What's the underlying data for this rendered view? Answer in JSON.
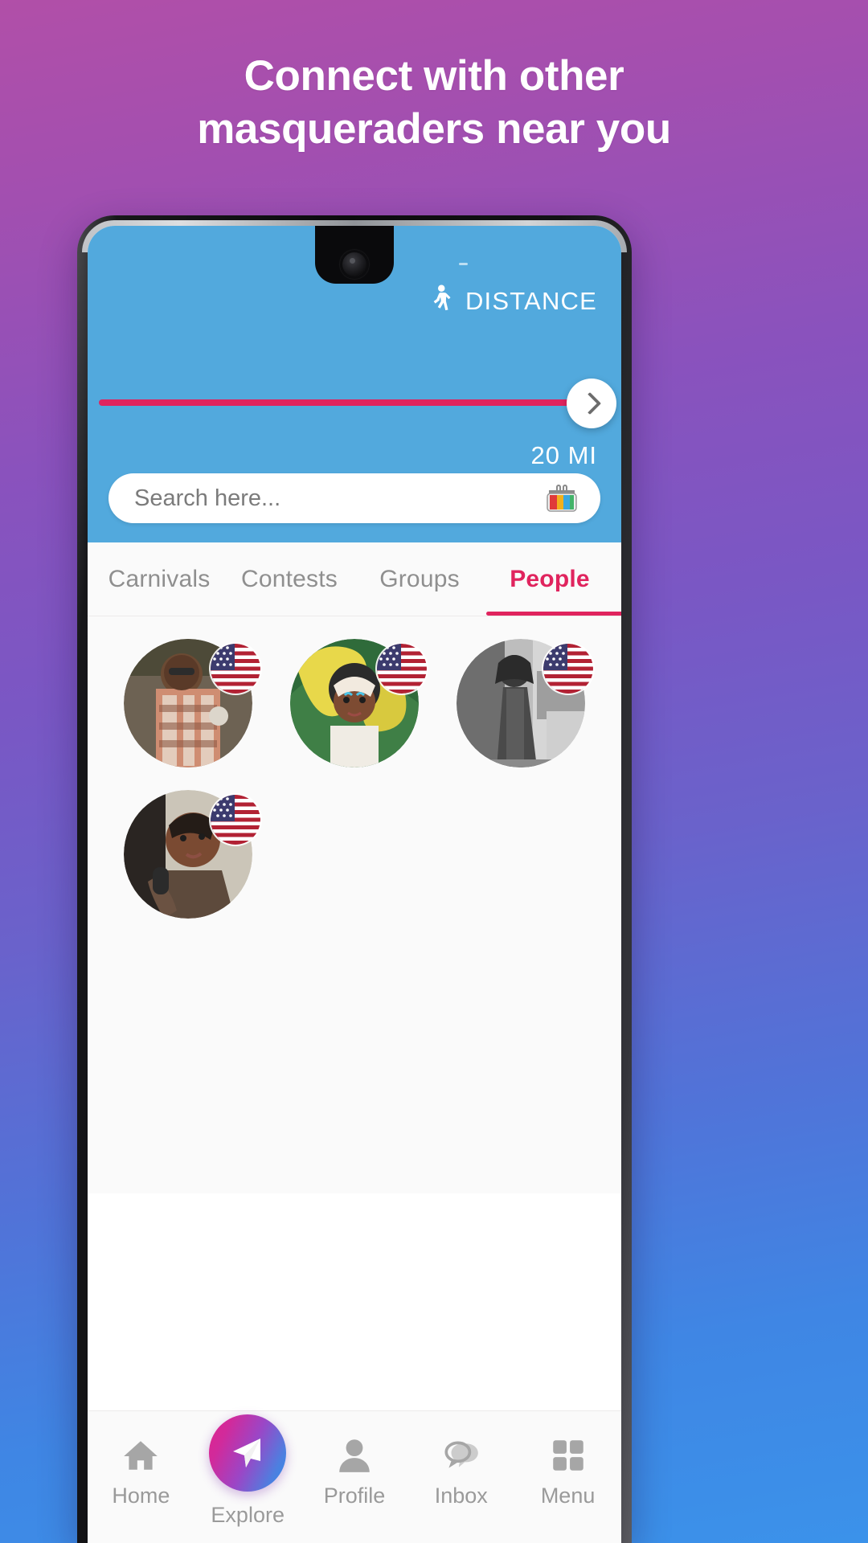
{
  "promo": {
    "headline_line1": "Connect with other",
    "headline_line2": "masqueraders near you",
    "bg_gradient_start": "#b14fa8",
    "bg_gradient_end": "#3b92ea"
  },
  "header": {
    "distance_label": "DISTANCE",
    "distance_icon": "walking-person-icon",
    "distance_value": "20 MI",
    "slider": {
      "track_color": "#e0245e",
      "fill_percent": 100,
      "thumb_icon": "chevron-right-icon"
    },
    "background_color": "#52a9dd"
  },
  "search": {
    "value": "",
    "placeholder": "Search here...",
    "icon": "carnival-mask-icon"
  },
  "tabs": [
    {
      "label": "Carnivals",
      "active": false
    },
    {
      "label": "Contests",
      "active": false
    },
    {
      "label": "Groups",
      "active": false
    },
    {
      "label": "People",
      "active": true
    }
  ],
  "tabs_active_color": "#e0245e",
  "people": [
    {
      "badge": "us-flag-badge",
      "photo_desc": "woman-in-patterned-dress"
    },
    {
      "badge": "us-flag-badge",
      "photo_desc": "woman-in-feathered-carnival-costume"
    },
    {
      "badge": "us-flag-badge",
      "photo_desc": "woman-black-and-white-photo"
    },
    {
      "badge": "us-flag-badge",
      "photo_desc": "woman-with-short-hair-smiling"
    }
  ],
  "bottom_nav": [
    {
      "label": "Home",
      "icon": "home-icon",
      "active": false
    },
    {
      "label": "Explore",
      "icon": "paper-plane-icon",
      "active": true
    },
    {
      "label": "Profile",
      "icon": "person-icon",
      "active": false
    },
    {
      "label": "Inbox",
      "icon": "chat-bubbles-icon",
      "active": false
    },
    {
      "label": "Menu",
      "icon": "grid-squares-icon",
      "active": false
    }
  ]
}
